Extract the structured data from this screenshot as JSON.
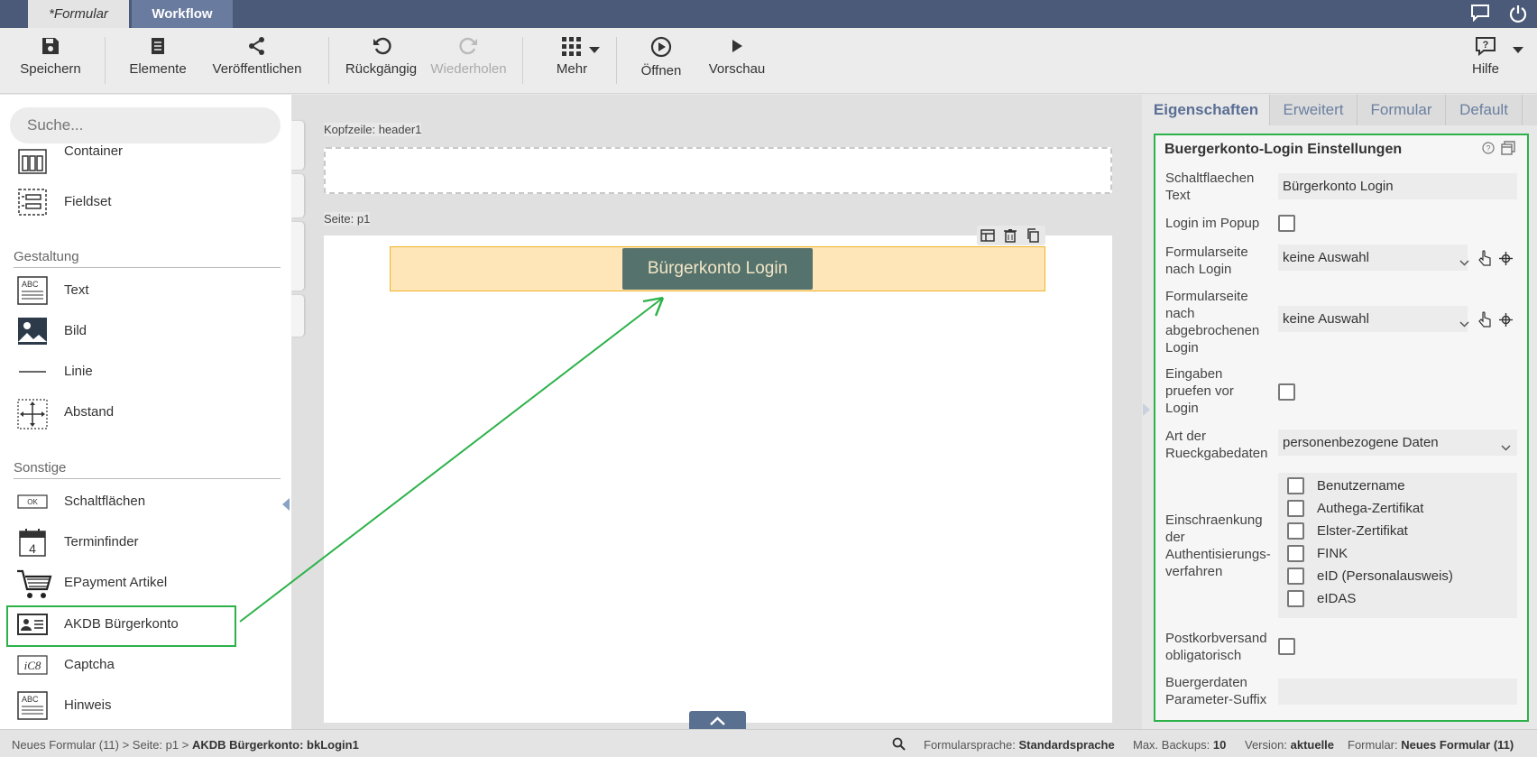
{
  "tabs": [
    {
      "label": "*Formular"
    },
    {
      "label": "Workflow"
    }
  ],
  "toolbar": {
    "save": "Speichern",
    "elements": "Elemente",
    "publish": "Veröffentlichen",
    "undo": "Rückgängig",
    "redo": "Wiederholen",
    "more": "Mehr",
    "open": "Öffnen",
    "preview": "Vorschau",
    "help": "Hilfe"
  },
  "left_panel": {
    "search_placeholder": "Suche...",
    "items_top": [
      {
        "label": "Container",
        "icon": "container-icon"
      },
      {
        "label": "Fieldset",
        "icon": "fieldset-icon"
      }
    ],
    "section_gestaltung": "Gestaltung",
    "items_gestaltung": [
      {
        "label": "Text",
        "icon": "text-icon"
      },
      {
        "label": "Bild",
        "icon": "image-icon"
      },
      {
        "label": "Linie",
        "icon": "line-icon"
      },
      {
        "label": "Abstand",
        "icon": "spacing-icon"
      }
    ],
    "section_sonstige": "Sonstige",
    "items_sonstige": [
      {
        "label": "Schaltflächen",
        "icon": "button-icon"
      },
      {
        "label": "Terminfinder",
        "icon": "calendar-icon"
      },
      {
        "label": "EPayment Artikel",
        "icon": "cart-icon"
      },
      {
        "label": "AKDB Bürgerkonto",
        "icon": "id-card-icon"
      },
      {
        "label": "Captcha",
        "icon": "captcha-icon"
      },
      {
        "label": "Hinweis",
        "icon": "note-icon"
      }
    ]
  },
  "canvas": {
    "header_label": "Kopfzeile: header1",
    "page_label": "Seite: p1",
    "button_text": "Bürgerkonto Login"
  },
  "right_panel": {
    "tabs": [
      "Eigenschaften",
      "Erweitert",
      "Formular",
      "Default"
    ],
    "title": "Buergerkonto-Login Einstellungen",
    "fields": {
      "button_text_label": "Schaltflaechen Text",
      "button_text_value": "Bürgerkonto Login",
      "popup_label": "Login im Popup",
      "page_after_login_label": "Formularseite nach Login",
      "page_after_login_value": "keine Auswahl",
      "page_after_cancel_label": "Formularseite nach abgebrochenen Login",
      "page_after_cancel_value": "keine Auswahl",
      "validate_label": "Eingaben pruefen vor Login",
      "return_data_label": "Art der Rueckgabedaten",
      "return_data_value": "personenbezogene Daten",
      "auth_label": "Einschraenkung der Authentisierungs-verfahren",
      "auth_options": [
        "Benutzername",
        "Authega-Zertifikat",
        "Elster-Zertifikat",
        "FINK",
        "eID (Personalausweis)",
        "eIDAS"
      ],
      "postbox_label": "Postkorbversand obligatorisch",
      "suffix_label": "Buergerdaten Parameter-Suffix",
      "suffix_value": ""
    }
  },
  "status_bar": {
    "crumb_1": "Neues Formular (11)",
    "crumb_sep": " > ",
    "crumb_2": "Seite: p1",
    "crumb_3": "AKDB Bürgerkonto: bkLogin1",
    "lang_label": "Formularsprache:",
    "lang_value": "Standardsprache",
    "backups_label": "Max. Backups:",
    "backups_value": "10",
    "version_label": "Version:",
    "version_value": "aktuelle",
    "form_label": "Formular:",
    "form_value": "Neues Formular (11)"
  },
  "colors": {
    "accent_green": "#2db24a",
    "topbar": "#4b5a78",
    "button_bg": "#55736c",
    "selection_bg": "#ffe6b8"
  }
}
